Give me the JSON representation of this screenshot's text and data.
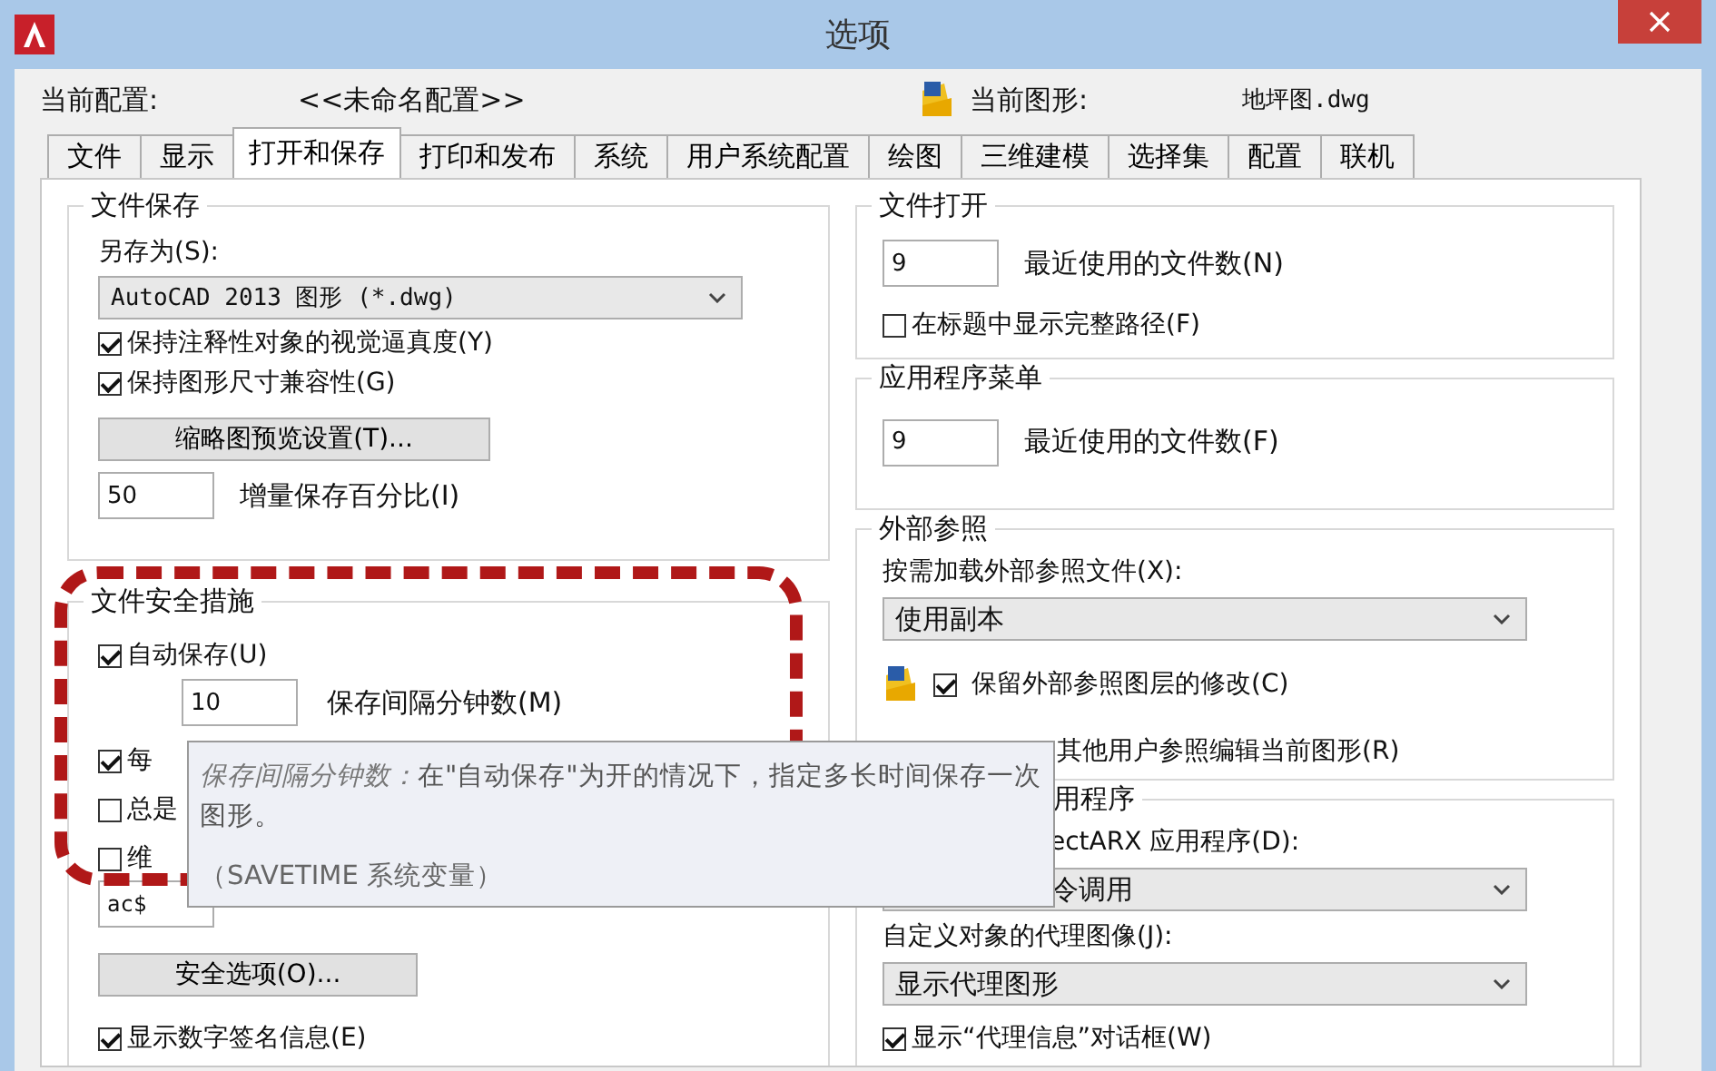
{
  "window": {
    "title": "选项"
  },
  "header": {
    "profile_label": "当前配置:",
    "profile_value": "<<未命名配置>>",
    "drawing_label": "当前图形:",
    "drawing_value": "地坪图.dwg"
  },
  "tabs": [
    {
      "label": "文件",
      "selected": false
    },
    {
      "label": "显示",
      "selected": false
    },
    {
      "label": "打开和保存",
      "selected": true
    },
    {
      "label": "打印和发布",
      "selected": false
    },
    {
      "label": "系统",
      "selected": false
    },
    {
      "label": "用户系统配置",
      "selected": false
    },
    {
      "label": "绘图",
      "selected": false
    },
    {
      "label": "三维建模",
      "selected": false
    },
    {
      "label": "选择集",
      "selected": false
    },
    {
      "label": "配置",
      "selected": false
    },
    {
      "label": "联机",
      "selected": false
    }
  ],
  "file_save": {
    "title": "文件保存",
    "save_as_label": "另存为(S):",
    "save_as_value": "AutoCAD 2013 图形 (*.dwg)",
    "checks": [
      {
        "label": "保持注释性对象的视觉逼真度(Y)",
        "checked": true
      },
      {
        "label": "保持图形尺寸兼容性(G)",
        "checked": true
      }
    ],
    "thumbnail_button": "缩略图预览设置(T)...",
    "incremental": {
      "value": "50",
      "label": "增量保存百分比(I)"
    }
  },
  "file_safety": {
    "title": "文件安全措施",
    "autosave": {
      "label": "自动保存(U)",
      "checked": true
    },
    "interval": {
      "value": "10",
      "label": "保存间隔分钟数(M)"
    },
    "checks": [
      {
        "label": "每",
        "checked": true
      },
      {
        "label": "总是",
        "checked": false
      },
      {
        "label": "维",
        "checked": false
      }
    ],
    "extension_value": "ac$",
    "security_button": "安全选项(O)...",
    "signature": {
      "label": "显示数字签名信息(E)",
      "checked": true
    }
  },
  "file_open": {
    "title": "文件打开",
    "recent": {
      "value": "9",
      "label": "最近使用的文件数(N)"
    },
    "full_path": {
      "label": "在标题中显示完整路径(F)",
      "checked": false
    }
  },
  "app_menu": {
    "title": "应用程序菜单",
    "recent": {
      "value": "9",
      "label": "最近使用的文件数(F)"
    }
  },
  "xref": {
    "title": "外部参照",
    "load_label": "按需加载外部参照文件(X):",
    "load_value": "使用副本",
    "retain": {
      "label": "保留外部参照图层的修改(C)",
      "checked": true
    },
    "allow_label": "其他用户参照编辑当前图形(R)"
  },
  "objectarx": {
    "title": "用程序",
    "load_label": "ectARX 应用程序(D):",
    "load_value": "令调用",
    "proxy_label": "自定义对象的代理图像(J):",
    "proxy_value": "显示代理图形",
    "proxy_dialog": {
      "label": "显示“代理信息”对话框(W)",
      "checked": true
    }
  },
  "tooltip": {
    "term": "保存间隔分钟数：",
    "text": "在\"自动保存\"为开的情况下，指定多长时间保存一次图形。",
    "note": "（SAVETIME 系统变量）"
  }
}
